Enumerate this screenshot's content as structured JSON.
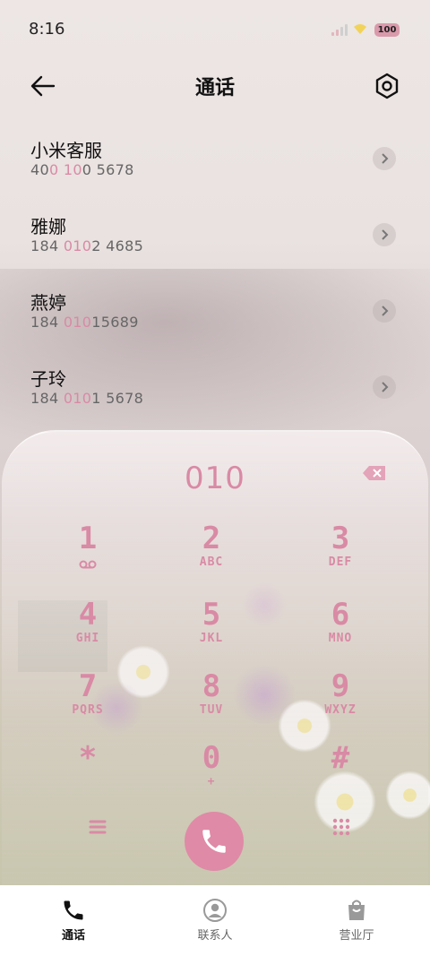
{
  "status_bar": {
    "time": "8:16",
    "battery": "100"
  },
  "header": {
    "title": "通话"
  },
  "contacts": [
    {
      "name": "小米客服",
      "number_parts": [
        "40",
        "0 10",
        "0 5678"
      ]
    },
    {
      "name": "雅娜",
      "number_parts": [
        "184 ",
        "010",
        "2 4685"
      ]
    },
    {
      "name": "燕婷",
      "number_parts": [
        "184 ",
        "010",
        "15689"
      ]
    },
    {
      "name": "子玲",
      "number_parts": [
        "184 ",
        "010",
        "1 5678"
      ]
    }
  ],
  "dialpad": {
    "display": "010",
    "keys": [
      {
        "digit": "1",
        "letters": ""
      },
      {
        "digit": "2",
        "letters": "ABC"
      },
      {
        "digit": "3",
        "letters": "DEF"
      },
      {
        "digit": "4",
        "letters": "GHI"
      },
      {
        "digit": "5",
        "letters": "JKL"
      },
      {
        "digit": "6",
        "letters": "MNO"
      },
      {
        "digit": "7",
        "letters": "PQRS"
      },
      {
        "digit": "8",
        "letters": "TUV"
      },
      {
        "digit": "9",
        "letters": "WXYZ"
      },
      {
        "digit": "*",
        "letters": ""
      },
      {
        "digit": "0",
        "letters": "+"
      },
      {
        "digit": "#",
        "letters": ""
      }
    ]
  },
  "tabs": [
    {
      "label": "通话",
      "icon": "phone-icon",
      "active": true
    },
    {
      "label": "联系人",
      "icon": "contacts-icon",
      "active": false
    },
    {
      "label": "营业厅",
      "icon": "store-bag-icon",
      "active": false
    }
  ],
  "colors": {
    "accent": "#d98aa5",
    "call_button": "#df8aa6"
  }
}
